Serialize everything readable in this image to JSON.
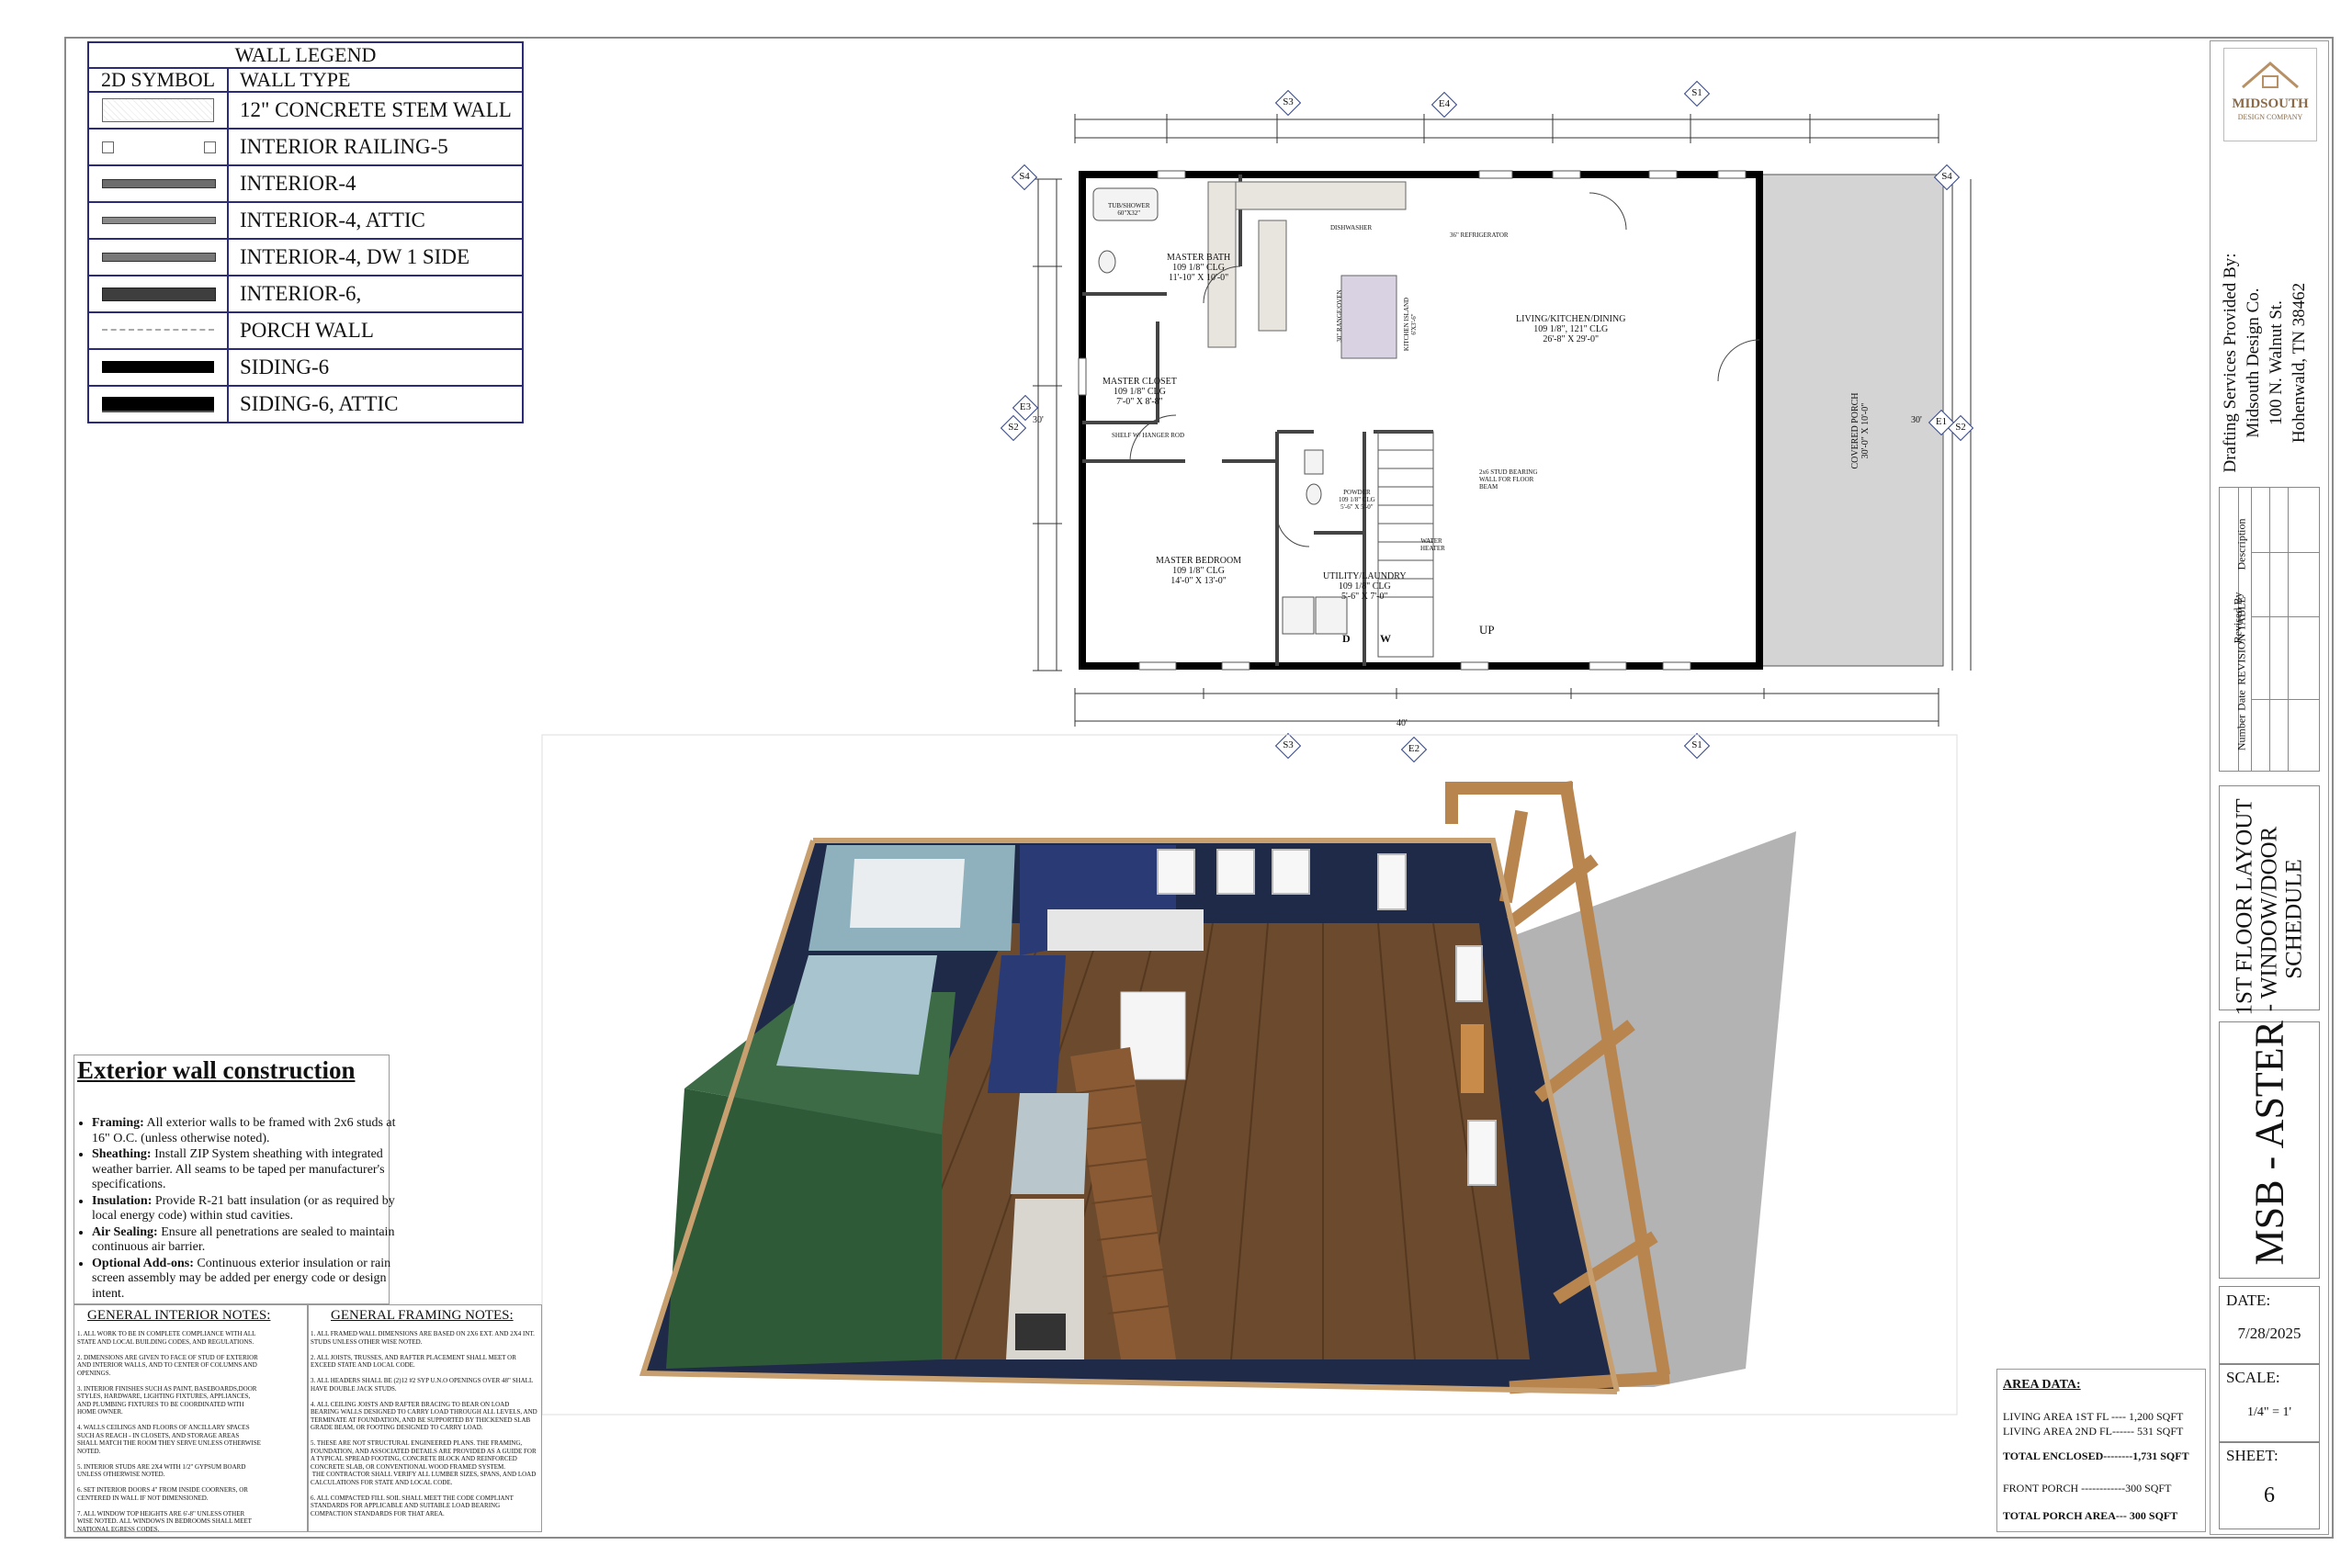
{
  "legend": {
    "title": "WALL LEGEND",
    "col_symbol": "2D SYMBOL",
    "col_type": "WALL TYPE",
    "rows": [
      {
        "label": "12\" CONCRETE STEM WALL",
        "symbol": "concrete"
      },
      {
        "label": "INTERIOR RAILING-5",
        "symbol": "railing"
      },
      {
        "label": "INTERIOR-4",
        "symbol": "int4"
      },
      {
        "label": "INTERIOR-4, ATTIC",
        "symbol": "int4attic"
      },
      {
        "label": "INTERIOR-4, DW 1 SIDE",
        "symbol": "int4dw"
      },
      {
        "label": "INTERIOR-6,",
        "symbol": "int6"
      },
      {
        "label": "PORCH WALL",
        "symbol": "porch"
      },
      {
        "label": "SIDING-6",
        "symbol": "siding"
      },
      {
        "label": "SIDING-6, ATTIC",
        "symbol": "sidingattic"
      }
    ]
  },
  "exterior": {
    "title": "Exterior wall construction",
    "items": [
      {
        "key": "Framing:",
        "text": "All exterior walls to be framed with 2x6 studs at 16\" O.C. (unless otherwise noted)."
      },
      {
        "key": "Sheathing:",
        "text": "Install ZIP System sheathing with integrated weather barrier. All seams to be taped per manufacturer's specifications."
      },
      {
        "key": "Insulation:",
        "text": "Provide R-21 batt insulation (or as required by local energy code) within stud cavities."
      },
      {
        "key": "Air Sealing:",
        "text": "Ensure all penetrations are sealed to maintain continuous air barrier."
      },
      {
        "key": "Optional Add-ons:",
        "text": "Continuous exterior insulation or rain screen assembly may be added per energy code or design intent."
      }
    ]
  },
  "interior_notes": {
    "title": "GENERAL INTERIOR NOTES:",
    "text": "1. ALL WORK TO BE IN COMPLETE COMPLIANCE WITH ALL STATE AND LOCAL BUILDING CODES, AND REGULATIONS.\n\n2. DIMENSIONS ARE GIVEN TO FACE OF STUD OF EXTERIOR AND INTERIOR WALLS, AND TO CENTER OF COLUMNS AND OPENINGS.\n\n3. INTERIOR FINISHES SUCH AS PAINT, BASEBOARDS,DOOR STYLES, HARDWARE, LIGHTING FIXTURES, APPLIANCES, AND PLUMBING FIXTURES TO BE COORDINATED WITH HOME OWNER.\n\n4. WALLS CEILINGS AND FLOORS OF ANCILLARY SPACES SUCH AS REACH - IN CLOSETS, AND STORAGE AREAS SHALL MATCH THE ROOM THEY SERVE UNLESS OTHERWISE NOTED.\n\n5. INTERIOR STUDS ARE 2X4 WITH 1/2\" GYPSUM BOARD UNLESS OTHERWISE NOTED.\n\n6. SET INTERIOR DOORS 4\" FROM INSIDE COORNERS, OR CENTERED IN WALL IF NOT DIMENSIONED.\n\n7. ALL WINDOW TOP HEIGHTS ARE 6'-8\" UNLESS OTHER WISE NOTED. ALL WINDOWS IN BEDROOMS SHALL MEET NATIONAL EGRESS CODES."
  },
  "framing_notes": {
    "title": "GENERAL FRAMING NOTES:",
    "text": "1. ALL FRAMED WALL DIMENSIONS ARE BASED ON 2X6 EXT. AND 2X4 INT. STUDS UNLESS OTHER WISE NOTED.\n\n2. ALL JOISTS, TRUSSES, AND RAFTER PLACEMENT SHALL MEET OR EXCEED STATE AND LOCAL CODE.\n\n3. ALL HEADERS SHALL BE (2)12 #2 SYP U.N.O OPENINGS OVER 48\" SHALL HAVE DOUBLE JACK STUDS.\n\n4. ALL CEILING JOISTS AND RAFTER BRACING TO BEAR ON LOAD BEARING WALLS DESIGNED TO CARRY LOAD THROUGH ALL LEVELS, AND TERMINATE AT FOUNDATION, AND BE SUPPORTED BY THICKENED SLAB GRADE BEAM, OR FOOTING DESIGNED TO CARRY LOAD.\n\n5. THESE ARE NOT STRUCTURAL ENGINEERED PLANS. THE FRAMING, FOUNDATION, AND ASSOCIATED DETAILS ARE PROVIDED AS A GUIDE FOR A TYPICAL SPREAD FOOTING, CONCRETE BLOCK AND REINFORCED CONCRETE SLAB, OR CONVENTIONAL WOOD FRAMED SYSTEM.\n THE CONTRACTOR SHALL VERIFY ALL LUMBER SIZES, SPANS, AND LOAD CALCULATIONS FOR STATE AND LOCAL CODE.\n\n6. ALL COMPACTED FILL SOIL SHALL MEET THE CODE COMPLIANT STANDARDS FOR APPLICABLE AND SUITABLE LOAD BEARING COMPACTION STANDARDS FOR THAT AREA."
  },
  "area": {
    "title": "AREA DATA:",
    "line1": "LIVING AREA 1ST FL ---- 1,200 SQFT",
    "line2": "LIVING AREA 2ND FL------ 531 SQFT",
    "line3": "TOTAL ENCLOSED--------1,731 SQFT",
    "line4": "FRONT PORCH ------------300  SQFT",
    "line5": "TOTAL PORCH AREA--- 300 SQFT"
  },
  "titleblock": {
    "logo_name": "MIDSOUTH",
    "logo_sub": "DESIGN COMPANY",
    "provided_by": "Drafting Services Provided By:",
    "company": "Midsouth Design Co.",
    "address1": "100 N. Walnut St.",
    "address2": "Hohenwald, TN 38462",
    "revision_title": "REVISION TABLE",
    "rev_cols": [
      "Number",
      "Date",
      "Revised By",
      "Description"
    ],
    "sheet_title_1": "1ST FLOOR LAYOUT",
    "sheet_title_2": "- WINDOW/DOOR",
    "sheet_title_3": "SCHEDULE",
    "project": "MSB - ASTER",
    "date_label": "DATE:",
    "date_value": "7/28/2025",
    "scale_label": "SCALE:",
    "scale_value": "1/4\" = 1'",
    "sheet_label": "SHEET:",
    "sheet_value": "6"
  },
  "plan": {
    "rooms": {
      "master_bath": [
        "MASTER BATH",
        "109 1/8\" CLG",
        "11'-10\" X 10'-0\""
      ],
      "living": [
        "LIVING/KITCHEN/DINING",
        "109 1/8\", 121\" CLG",
        "26'-8\" X 29'-0\""
      ],
      "master_closet": [
        "MASTER CLOSET",
        "109 1/8\" CLG",
        "7'-0\" X 8'-8\""
      ],
      "master_bed": [
        "MASTER BEDROOM",
        "109 1/8\" CLG",
        "14'-0\" X 13'-0\""
      ],
      "powder": [
        "POWDER",
        "109 1/8\" CLG",
        "5'-6\" X 5'-0\""
      ],
      "utility": [
        "UTILITY/LAUNDRY",
        "109 1/8\" CLG",
        "5'-6\" X 7'-0\""
      ],
      "porch": [
        "COVERED PORCH",
        "30'-0\" X 10'-0\""
      ]
    },
    "labels": {
      "tub": "TUB/SHOWER",
      "tub_size": "60\"X32\"",
      "dishwasher": "DISHWASHER",
      "refrigerator": "36\" REFRIGERATOR",
      "range": "30\" RANGE/OVEN",
      "island": "KITCHEN ISLAND",
      "island_size": "6'X3'-6\"",
      "shelf": "SHELF W/ HANGER ROD",
      "beam": "2x6 STUD BEARING WALL FOR FLOOR BEAM",
      "water_heater": "WATER HEATER",
      "up": "UP",
      "dryer": "D",
      "washer": "W",
      "dim_30_left": "30'",
      "dim_30_right": "30'",
      "dim_40": "40'"
    },
    "markers": {
      "s3_top": "S3",
      "e4_top": "E4",
      "s1_top": "S1",
      "s4_left": "S4",
      "s4_right": "S4",
      "e3": "E3",
      "s2_left": "S2",
      "e1": "E1",
      "s2_right": "S2",
      "s3_bottom": "S3",
      "e2": "E2",
      "s1_bottom": "S1"
    }
  },
  "colors": {
    "legend_border": "#2b2b7a",
    "marker": "#2b3f8a",
    "wood_floor": "#6b4a2e",
    "bath_wall": "#8fb0bd",
    "green_wall": "#2f5a38",
    "navy_wall": "#27315c",
    "porch_floor": "#b3b3b3",
    "timber": "#b9854f"
  }
}
